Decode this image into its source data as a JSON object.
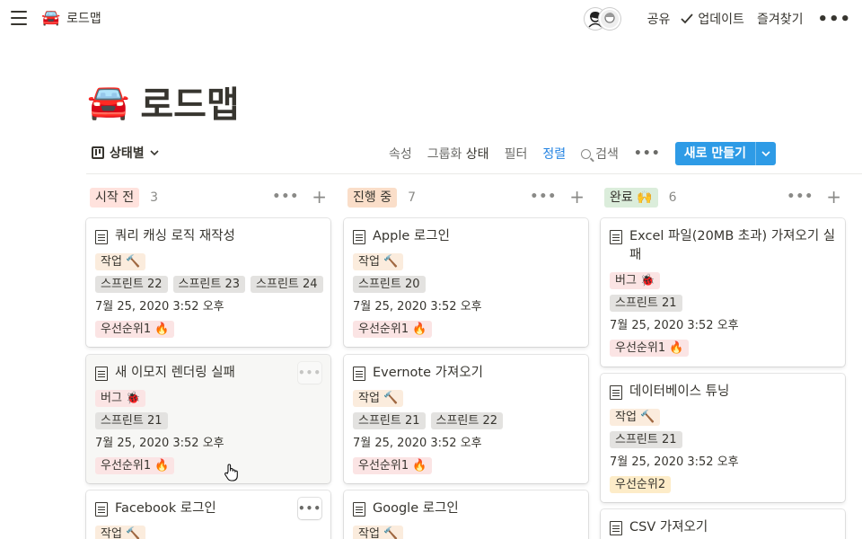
{
  "breadcrumb": {
    "emoji": "🚘",
    "title": "로드맵"
  },
  "topbar": {
    "share": "공유",
    "updates": "업데이트",
    "favorite": "즐겨찾기",
    "more": "•••"
  },
  "page": {
    "emoji": "🚘",
    "title": "로드맵"
  },
  "view": {
    "name": "상태별",
    "properties": "속성",
    "group_prefix": "그룹화",
    "group_value": "상태",
    "filter": "필터",
    "sort": "정렬",
    "search": "검색",
    "more": "•••",
    "new_button": "새로 만들기"
  },
  "colors": {
    "accent": "#2e9be6",
    "sort_active": "#2383e2"
  },
  "columns": [
    {
      "label": "시작 전",
      "count": "3",
      "color": "#ffe2dd",
      "cards": [
        {
          "title": "쿼리 캐싱 로직 재작성",
          "type": "작업 🔨",
          "sprints": [
            "스프린트 22",
            "스프린트 23",
            "스프린트 24"
          ],
          "date": "7월 25, 2020 3:52 오후",
          "priority": "우선순위1 🔥"
        },
        {
          "title": "새 이모지 렌더링 실패",
          "type": "버그 🐞",
          "sprints": [
            "스프린트 21"
          ],
          "date": "7월 25, 2020 3:52 오후",
          "priority": "우선순위1 🔥"
        },
        {
          "title": "Facebook 로그인",
          "type": "작업 🔨"
        }
      ]
    },
    {
      "label": "진행 중",
      "count": "7",
      "color": "#fadec9",
      "cards": [
        {
          "title": "Apple 로그인",
          "type": "작업 🔨",
          "sprints": [
            "스프린트 20"
          ],
          "date": "7월 25, 2020 3:52 오후",
          "priority": "우선순위1 🔥"
        },
        {
          "title": "Evernote 가져오기",
          "type": "작업 🔨",
          "sprints": [
            "스프린트 21",
            "스프린트 22"
          ],
          "date": "7월 25, 2020 3:52 오후",
          "priority": "우선순위1 🔥"
        },
        {
          "title": "Google 로그인",
          "type": "작업 🔨"
        }
      ]
    },
    {
      "label": "완료 🙌",
      "count": "6",
      "color": "#dbeddb",
      "cards": [
        {
          "title": "Excel 파일(20MB 초과) 가져오기 실패",
          "type": "버그 🐞",
          "sprints": [
            "스프린트 21"
          ],
          "date": "7월 25, 2020 3:52 오후",
          "priority": "우선순위1 🔥"
        },
        {
          "title": "데이터베이스 튜닝",
          "type": "작업 🔨",
          "sprints": [
            "스프린트 21"
          ],
          "date": "7월 25, 2020 3:52 오후",
          "priority": "우선순위2"
        },
        {
          "title": "CSV 가져오기"
        }
      ]
    }
  ]
}
